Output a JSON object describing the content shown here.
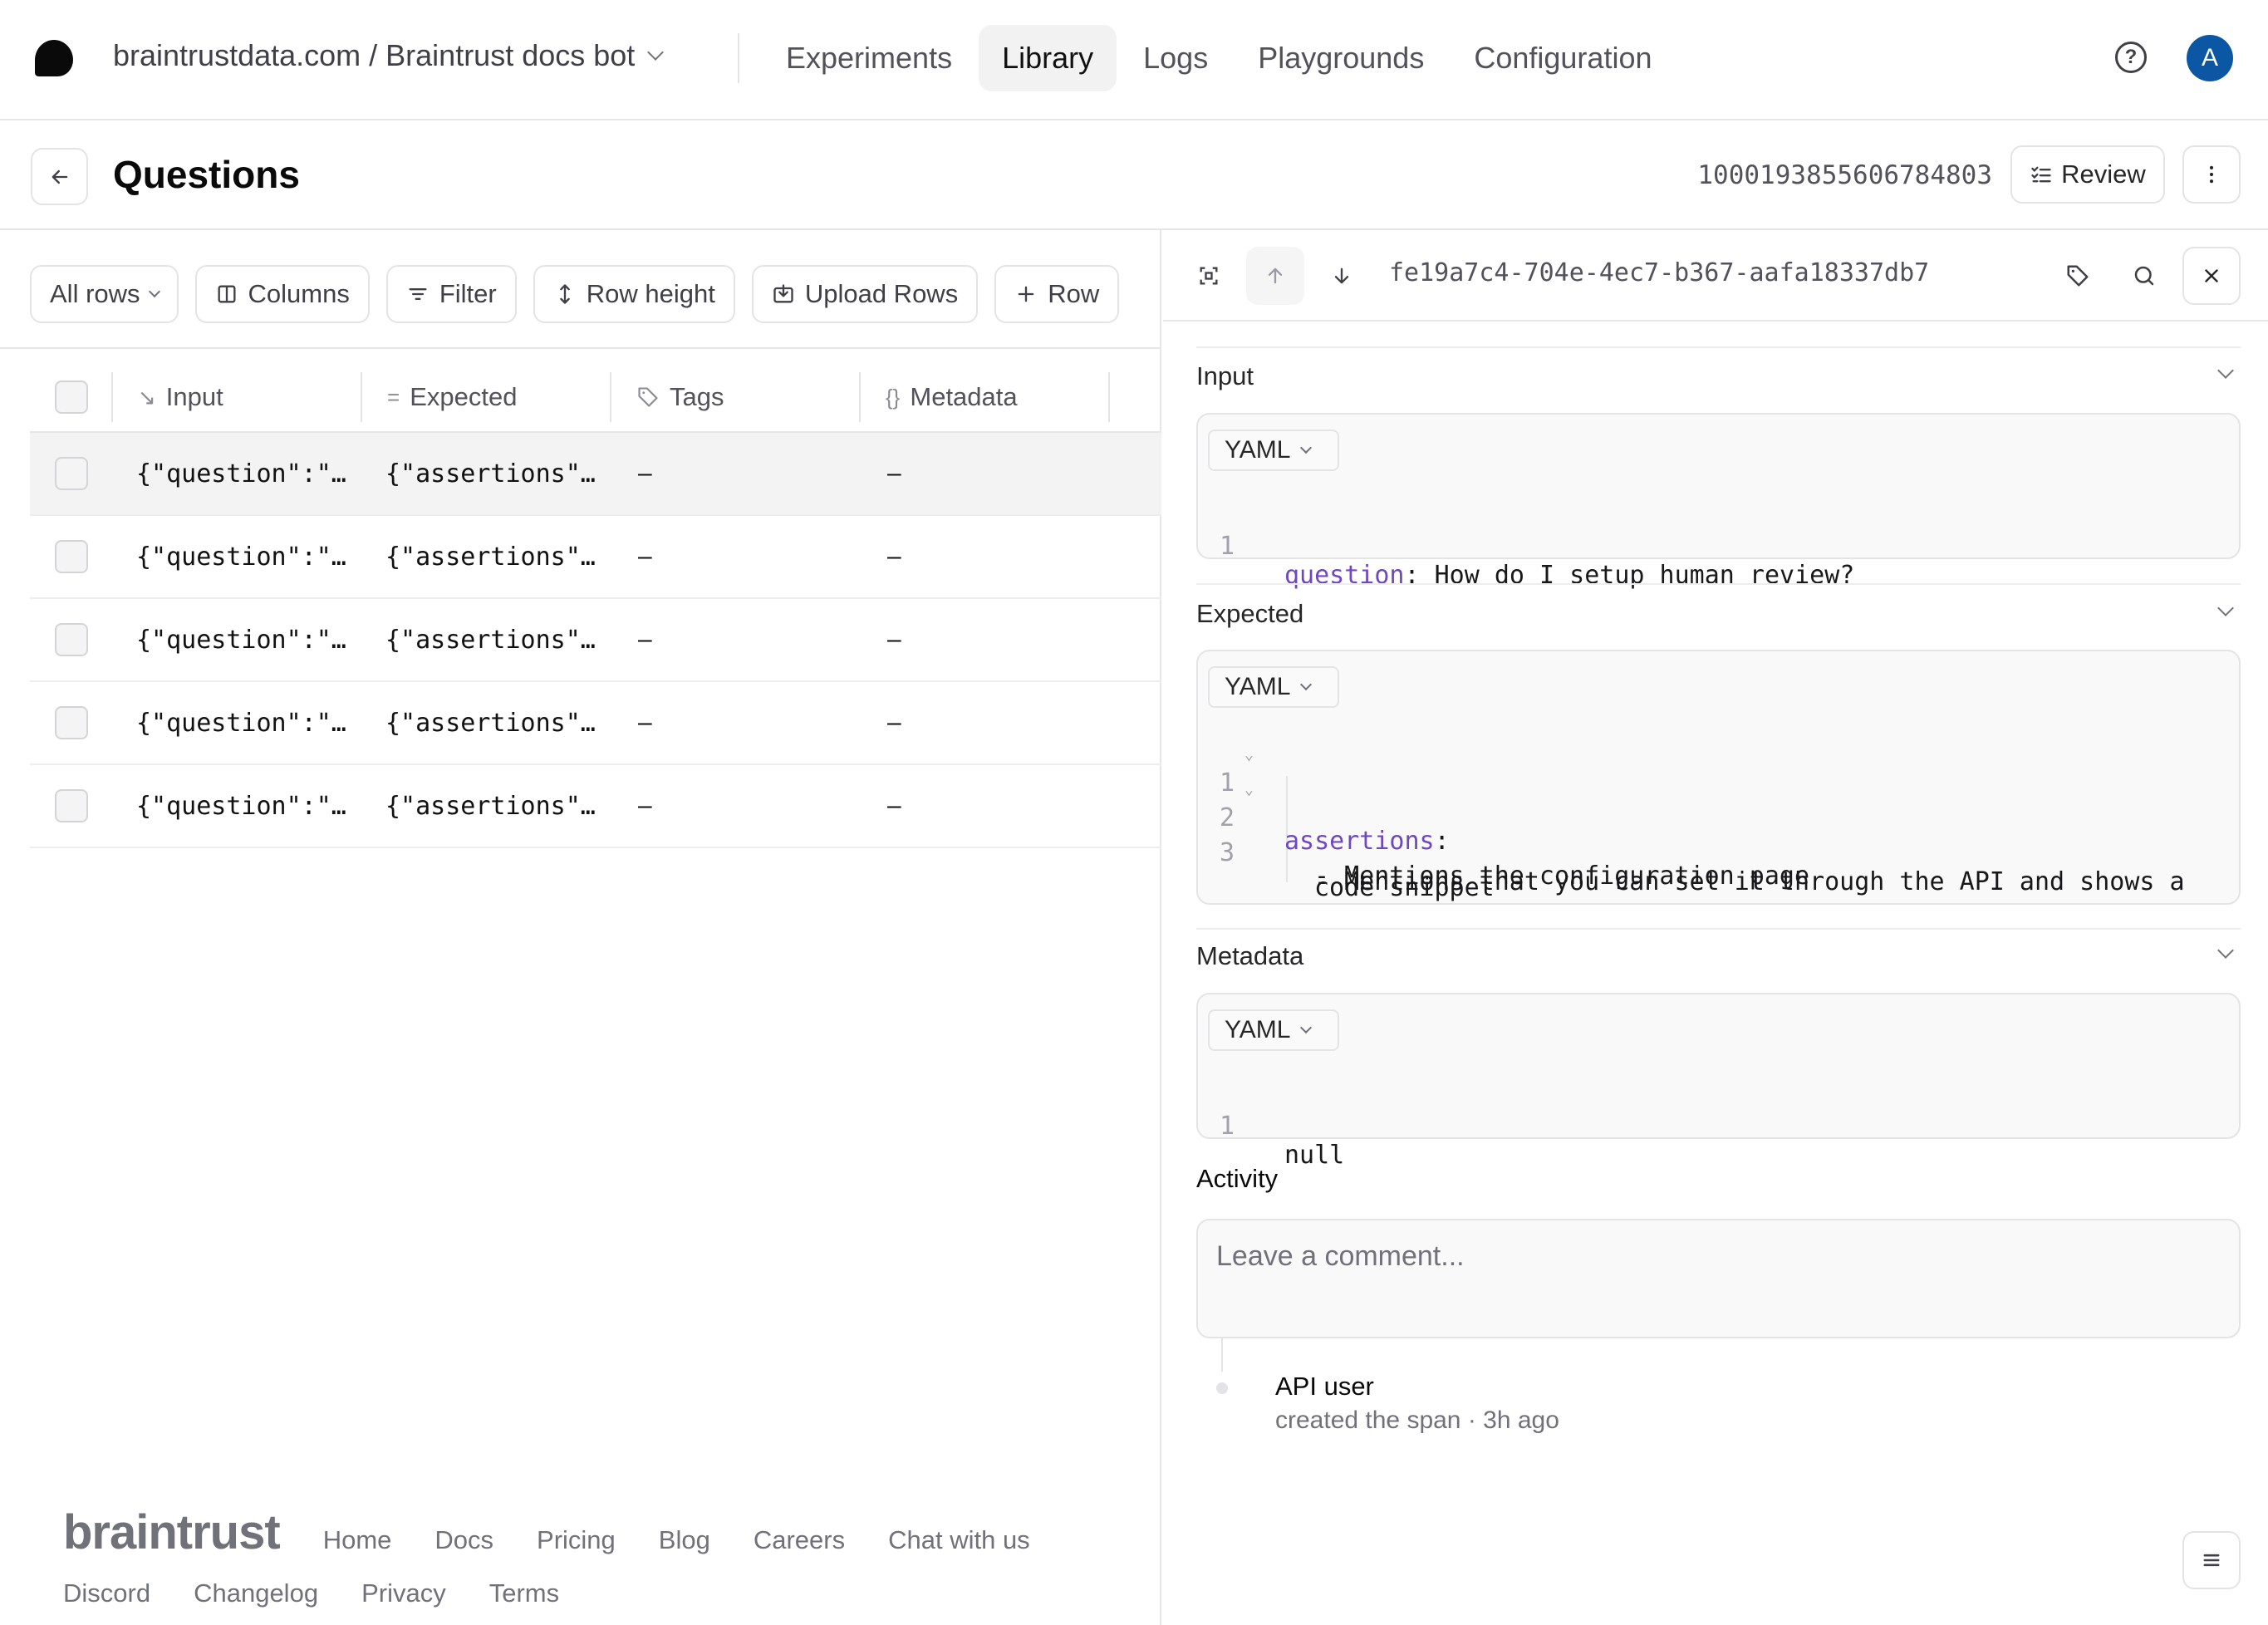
{
  "topnav": {
    "breadcrumb": "braintrustdata.com / Braintrust docs bot",
    "tabs": [
      {
        "label": "Experiments",
        "active": false
      },
      {
        "label": "Library",
        "active": true
      },
      {
        "label": "Logs",
        "active": false
      },
      {
        "label": "Playgrounds",
        "active": false
      },
      {
        "label": "Configuration",
        "active": false
      }
    ],
    "help_icon": "?",
    "avatar_initial": "A",
    "avatar_color": "#0b57a4"
  },
  "titlebar": {
    "title": "Questions",
    "dataset_id": "1000193855606784803",
    "review_label": "Review"
  },
  "toolbar": {
    "all_rows": "All rows",
    "columns": "Columns",
    "filter": "Filter",
    "row_height": "Row height",
    "upload_rows": "Upload Rows",
    "add_row": "Row"
  },
  "table": {
    "headers": [
      "Input",
      "Expected",
      "Tags",
      "Metadata"
    ],
    "rows": [
      {
        "input": "{\"question\":\"…",
        "expected": "{\"assertions\"…",
        "tags": "–",
        "metadata": "–",
        "highlighted": true
      },
      {
        "input": "{\"question\":\"…",
        "expected": "{\"assertions\"…",
        "tags": "–",
        "metadata": "–",
        "highlighted": false
      },
      {
        "input": "{\"question\":\"…",
        "expected": "{\"assertions\"…",
        "tags": "–",
        "metadata": "–",
        "highlighted": false
      },
      {
        "input": "{\"question\":\"…",
        "expected": "{\"assertions\"…",
        "tags": "–",
        "metadata": "–",
        "highlighted": false
      },
      {
        "input": "{\"question\":\"…",
        "expected": "{\"assertions\"…",
        "tags": "–",
        "metadata": "–",
        "highlighted": false
      }
    ]
  },
  "footer": {
    "brand": "braintrust",
    "links_row1": [
      "Home",
      "Docs",
      "Pricing",
      "Blog",
      "Careers",
      "Chat with us"
    ],
    "links_row2": [
      "Discord",
      "Changelog",
      "Privacy",
      "Terms"
    ]
  },
  "detail": {
    "span_id": "fe19a7c4-704e-4ec7-b367-aafa18337db7",
    "input": {
      "label": "Input",
      "format": "YAML",
      "lines": [
        {
          "n": "1",
          "key": "question",
          "text": ": How do I setup human review?"
        }
      ]
    },
    "expected": {
      "label": "Expected",
      "format": "YAML",
      "lines": [
        {
          "n": "1",
          "key": "assertions",
          "text": ":"
        },
        {
          "n": "2",
          "text": "- Mentions the configuration page"
        },
        {
          "n": "3",
          "text": "- Mentions that you can set it through the API and shows a"
        },
        {
          "n": "",
          "text": "code snippet"
        }
      ]
    },
    "metadata": {
      "label": "Metadata",
      "format": "YAML",
      "lines": [
        {
          "n": "1",
          "text": "null"
        }
      ]
    },
    "activity": {
      "label": "Activity",
      "comment_placeholder": "Leave a comment...",
      "events": [
        {
          "user": "API user",
          "description": "created the span · 3h ago"
        }
      ]
    }
  },
  "colors": {
    "yaml_key": "#7047c2",
    "accent_avatar": "#0b57a4",
    "row_highlight": "#f3f3f4"
  }
}
